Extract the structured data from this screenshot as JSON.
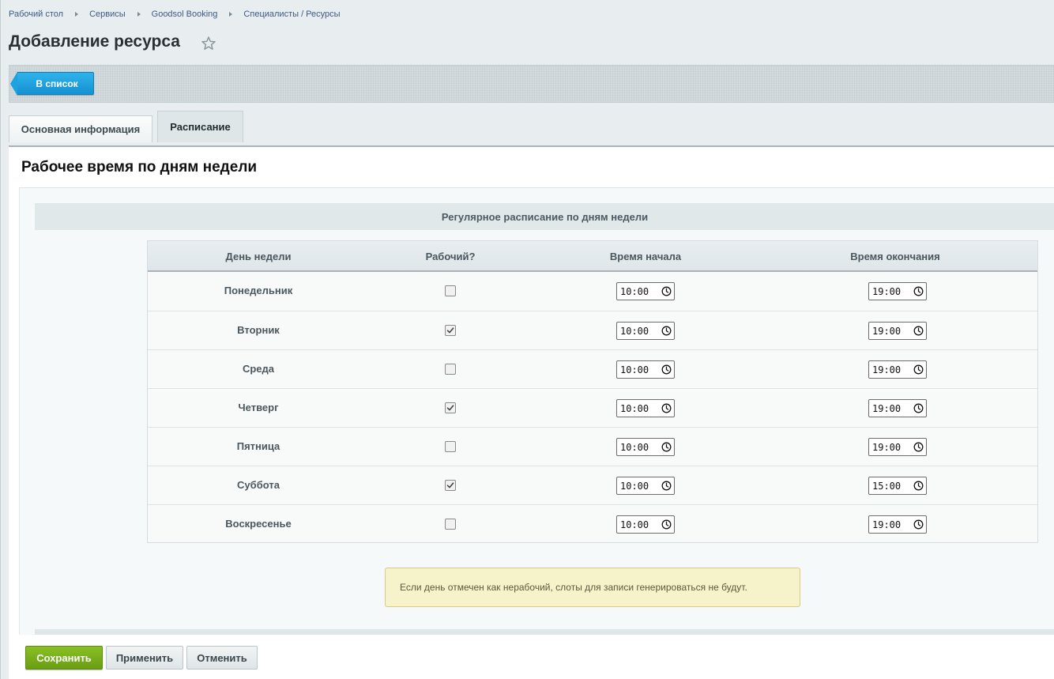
{
  "breadcrumbs": [
    "Рабочий стол",
    "Сервисы",
    "Goodsol Booking",
    "Специалисты / Ресурсы"
  ],
  "page_title": "Добавление ресурса",
  "toolbar": {
    "back_label": "В список"
  },
  "tabs": [
    {
      "label": "Основная информация",
      "active": false
    },
    {
      "label": "Расписание",
      "active": true
    }
  ],
  "section_heading": "Рабочее время по дням недели",
  "schedule_header": "Регулярное расписание по дням недели",
  "table": {
    "columns": [
      "День недели",
      "Рабочий?",
      "Время начала",
      "Время окончания"
    ],
    "rows": [
      {
        "day": "Понедельник",
        "working": false,
        "start": "10:00",
        "end": "19:00"
      },
      {
        "day": "Вторник",
        "working": true,
        "start": "10:00",
        "end": "19:00"
      },
      {
        "day": "Среда",
        "working": false,
        "start": "10:00",
        "end": "19:00"
      },
      {
        "day": "Четверг",
        "working": true,
        "start": "10:00",
        "end": "19:00"
      },
      {
        "day": "Пятница",
        "working": false,
        "start": "10:00",
        "end": "19:00"
      },
      {
        "day": "Суббота",
        "working": true,
        "start": "10:00",
        "end": "15:00"
      },
      {
        "day": "Воскресенье",
        "working": false,
        "start": "10:00",
        "end": "19:00"
      }
    ]
  },
  "note": "Если день отмечен как нерабочий, слоты для записи генерироваться не будут.",
  "buttons": {
    "save": "Сохранить",
    "apply": "Применить",
    "cancel": "Отменить"
  },
  "colors": {
    "accent_blue": "#1ca2df",
    "save_green": "#7ab01b",
    "note_bg": "#f6f2c9"
  },
  "icons": {
    "favorite": "star-icon",
    "time": "clock-icon",
    "check": "checkmark-icon"
  }
}
